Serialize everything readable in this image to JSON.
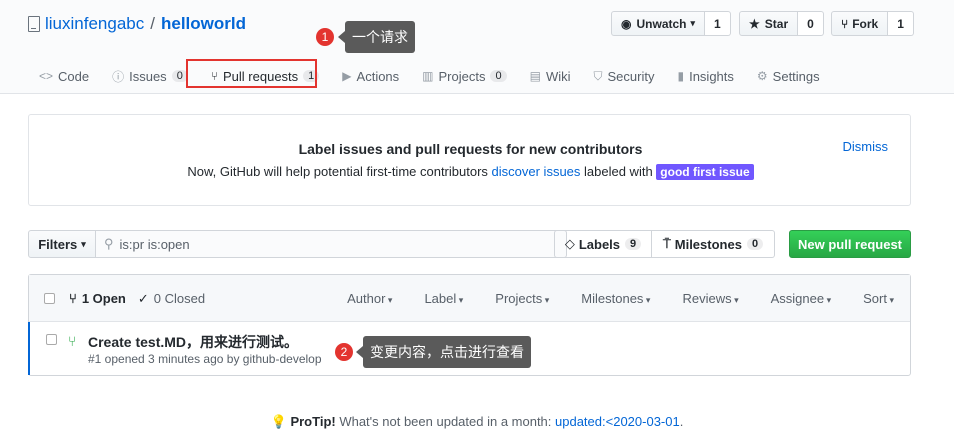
{
  "repo": {
    "owner": "liuxinfengabc",
    "separator": "/",
    "name": "helloworld"
  },
  "actions": {
    "watch_label": "Unwatch",
    "watch_count": "1",
    "star_label": "Star",
    "star_count": "0",
    "fork_label": "Fork",
    "fork_count": "1"
  },
  "tabs": [
    {
      "label": "Code",
      "icon": "code-icon"
    },
    {
      "label": "Issues",
      "count": "0",
      "icon": "issue-icon"
    },
    {
      "label": "Pull requests",
      "count": "1",
      "icon": "pull-request-icon"
    },
    {
      "label": "Actions",
      "icon": "play-icon"
    },
    {
      "label": "Projects",
      "count": "0",
      "icon": "project-icon"
    },
    {
      "label": "Wiki",
      "icon": "book-icon"
    },
    {
      "label": "Security",
      "icon": "shield-icon"
    },
    {
      "label": "Insights",
      "icon": "graph-icon"
    },
    {
      "label": "Settings",
      "icon": "gear-icon"
    }
  ],
  "annotations": [
    {
      "number": "1",
      "text": "一个请求"
    },
    {
      "number": "2",
      "text": "变更内容，点击进行查看"
    }
  ],
  "banner": {
    "title": "Label issues and pull requests for new contributors",
    "text_before": "Now, GitHub will help potential first-time contributors ",
    "link": "discover issues",
    "text_after": " labeled with ",
    "badge": "good first issue",
    "dismiss": "Dismiss"
  },
  "filterbar": {
    "filters_label": "Filters",
    "search_value": "is:pr is:open",
    "labels_label": "Labels",
    "labels_count": "9",
    "milestones_label": "Milestones",
    "milestones_count": "0",
    "new_pr_label": "New pull request"
  },
  "list": {
    "open_label": "1 Open",
    "closed_label": "0 Closed",
    "filters": [
      "Author",
      "Label",
      "Projects",
      "Milestones",
      "Reviews",
      "Assignee",
      "Sort"
    ]
  },
  "pull_request": {
    "title": "Create test.MD，用来进行测试。",
    "meta": "#1 opened 3 minutes ago by github-develop"
  },
  "protip": {
    "bold": "ProTip!",
    "text": " What's not been updated in a month: ",
    "link": "updated:<2020-03-01",
    "end": "."
  },
  "colors": {
    "accent": "#0366d6",
    "green": "#28a745",
    "badge": "#7057ff",
    "annotation_red": "#e3342f",
    "callout_bg": "#5a5a5a"
  }
}
